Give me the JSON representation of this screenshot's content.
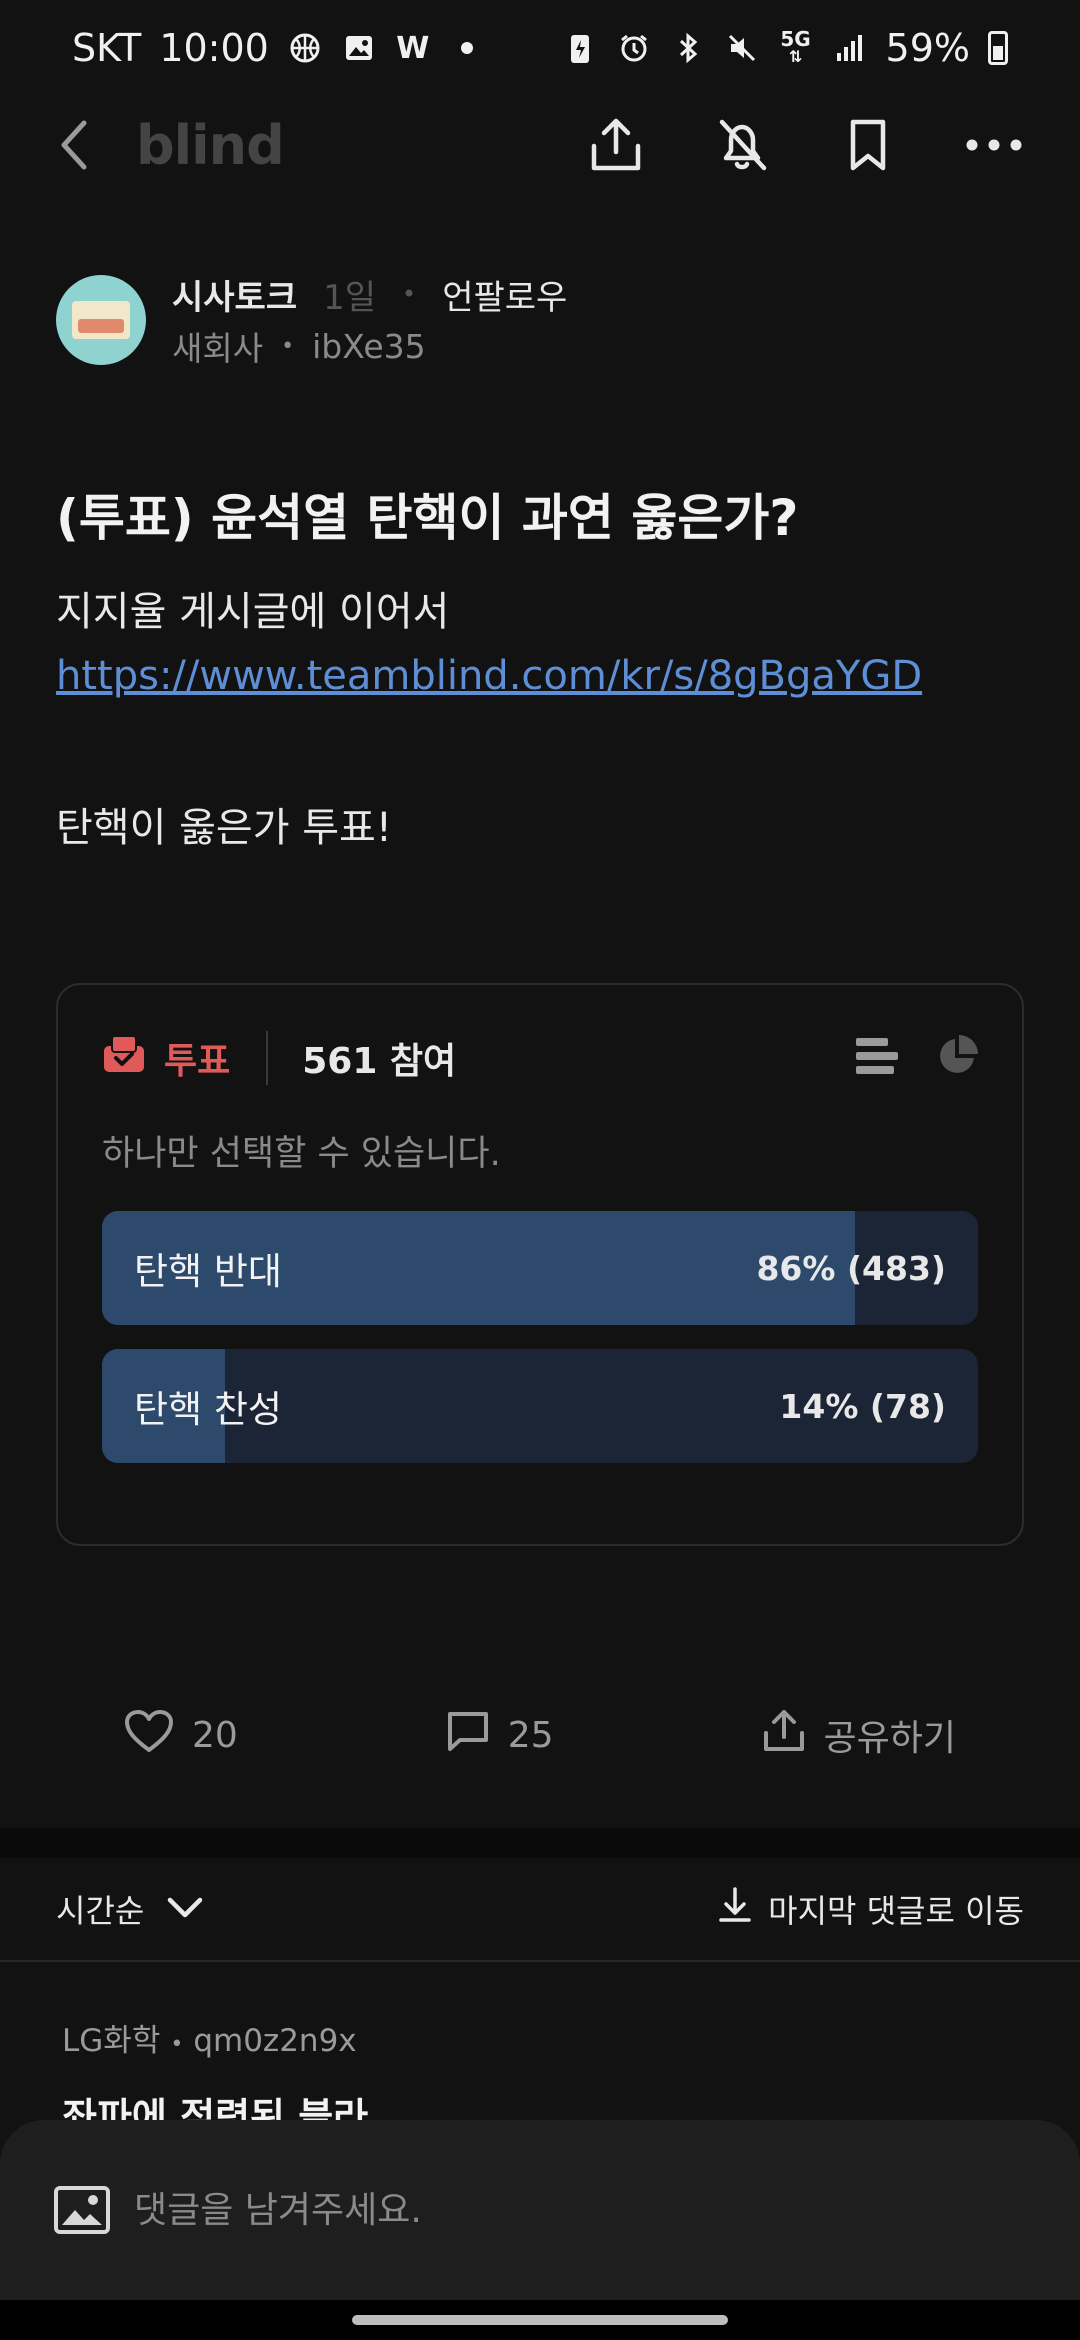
{
  "status_bar": {
    "carrier": "SKT",
    "time": "10:00",
    "network": "5G",
    "battery": "59%"
  },
  "header": {
    "logo": "blind"
  },
  "author": {
    "board": "시사토크",
    "time_ago": "1일",
    "follow_label": "언팔로우",
    "company": "새회사",
    "user_id": "ibXe35"
  },
  "post": {
    "title": "(투표) 윤석열 탄핵이 과연 옳은가?",
    "line1": "지지율 게시글에 이어서",
    "link": "https://www.teamblind.com/kr/s/8gBgaYGD",
    "line2": "탄핵이 옳은가 투표!"
  },
  "poll": {
    "tag_label": "투표",
    "participants": "561 참여",
    "hint": "하나만 선택할 수 있습니다.",
    "options": [
      {
        "label": "탄핵 반대",
        "result": "86% (483)",
        "fraction": 0.86
      },
      {
        "label": "탄핵 찬성",
        "result": "14% (78)",
        "fraction": 0.14
      }
    ],
    "colors": {
      "fill": "#2d4a6c",
      "track": "#1c2535",
      "accent": "#e05a5a"
    }
  },
  "actions": {
    "likes": "20",
    "comments": "25",
    "share_label": "공유하기"
  },
  "comments_bar": {
    "sort_label": "시간순",
    "jump_label": "마지막 댓글로 이동"
  },
  "comment_preview": {
    "company": "LG화학",
    "user_id": "qm0z2n9x",
    "text": "좌파에 점령된 블라"
  },
  "comment_input": {
    "placeholder": "댓글을 남겨주세요."
  }
}
